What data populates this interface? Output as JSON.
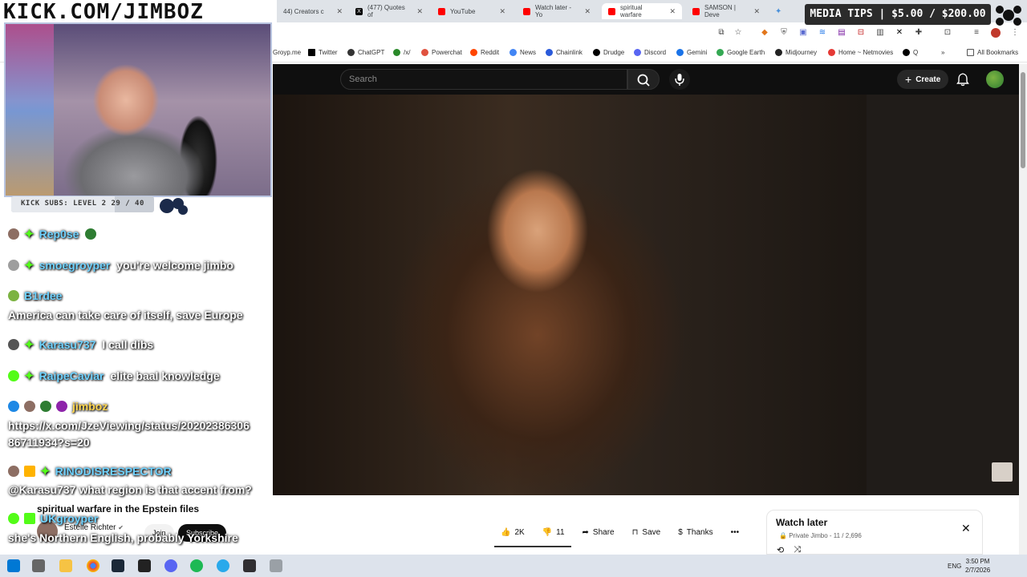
{
  "overlay": {
    "logo_text": "KICK.COM/JIMBOZ",
    "subs_text": "KICK SUBS: LEVEL 2 29 / 40",
    "subs_progress": 0.725,
    "tips_text": "MEDIA TIPS | $5.00 / $200.00"
  },
  "browser": {
    "tabs": [
      {
        "label": "44) Creators c",
        "icon": "creator-icon",
        "color": "#888888"
      },
      {
        "label": "(477) Quotes of",
        "icon": "x-icon",
        "color": "#000000"
      },
      {
        "label": "YouTube",
        "icon": "youtube-icon",
        "color": "#ff0000"
      },
      {
        "label": "Watch later - Yo",
        "icon": "youtube-icon",
        "color": "#ff0000"
      },
      {
        "label": "spiritual warfare",
        "icon": "youtube-icon",
        "color": "#ff0000"
      },
      {
        "label": "SAMSON | Deve",
        "icon": "youtube-icon",
        "color": "#ff0000"
      }
    ],
    "bookmarks": [
      {
        "label": "Groyp.me",
        "color": "#777777"
      },
      {
        "label": "Twitter",
        "color": "#000000"
      },
      {
        "label": "ChatGPT",
        "color": "#333333"
      },
      {
        "label": "/x/",
        "color": "#2a8a2a"
      },
      {
        "label": "Powerchat",
        "color": "#e0523f"
      },
      {
        "label": "Reddit",
        "color": "#ff4500"
      },
      {
        "label": "News",
        "color": "#4285f4"
      },
      {
        "label": "Chainlink",
        "color": "#2a5ada"
      },
      {
        "label": "Drudge",
        "color": "#000000"
      },
      {
        "label": "Discord",
        "color": "#5865f2"
      },
      {
        "label": "Gemini",
        "color": "#1a73e8"
      },
      {
        "label": "Google Earth",
        "color": "#34a853"
      },
      {
        "label": "Midjourney",
        "color": "#222222"
      },
      {
        "label": "Home ~ Netmovies",
        "color": "#e53935"
      },
      {
        "label": "Q",
        "color": "#000000"
      },
      {
        "label": "All Bookmarks",
        "color": "#555555"
      }
    ]
  },
  "youtube": {
    "search_placeholder": "Search",
    "create_label": "Create",
    "video_title": "spiritual warfare in the Epstein files",
    "channel_name": "Estelle Richter",
    "join_label": "Join",
    "subscribe_label": "Subscribe",
    "likes": "2K",
    "dislikes": "11",
    "share_label": "Share",
    "save_label": "Save",
    "thanks_label": "Thanks",
    "watch_later": {
      "title": "Watch later",
      "subtitle": "Private Jimbo - 11 / 2,696"
    }
  },
  "chat": [
    {
      "user": "Rep0se",
      "text": "",
      "top": 0
    },
    {
      "user": "smoegroyper",
      "text": "you're welcome jimbo"
    },
    {
      "user": "B1rdee",
      "text": ""
    },
    {
      "user": "",
      "text": "America can take care of itself, save Europe"
    },
    {
      "user": "Karasu737",
      "text": "I call dibs"
    },
    {
      "user": "RaipeCaviar",
      "text": "elite baal knowledge"
    },
    {
      "user": "jimboz",
      "text": ""
    },
    {
      "user": "",
      "text": "https://x.com/JzeViewing/status/20202386306"
    },
    {
      "user": "",
      "text": "86711934?s=20"
    },
    {
      "user": "RINODISRESPECTOR",
      "text": ""
    },
    {
      "user": "",
      "text": "@Karasu737 what region is that accent from?"
    },
    {
      "user": "UKgroyper",
      "text": ""
    },
    {
      "user": "",
      "text": "she's Northern English, probably Yorkshire"
    }
  ],
  "taskbar": {
    "language": "ENG",
    "time": "3:50 PM",
    "date": "2/7/2026"
  }
}
